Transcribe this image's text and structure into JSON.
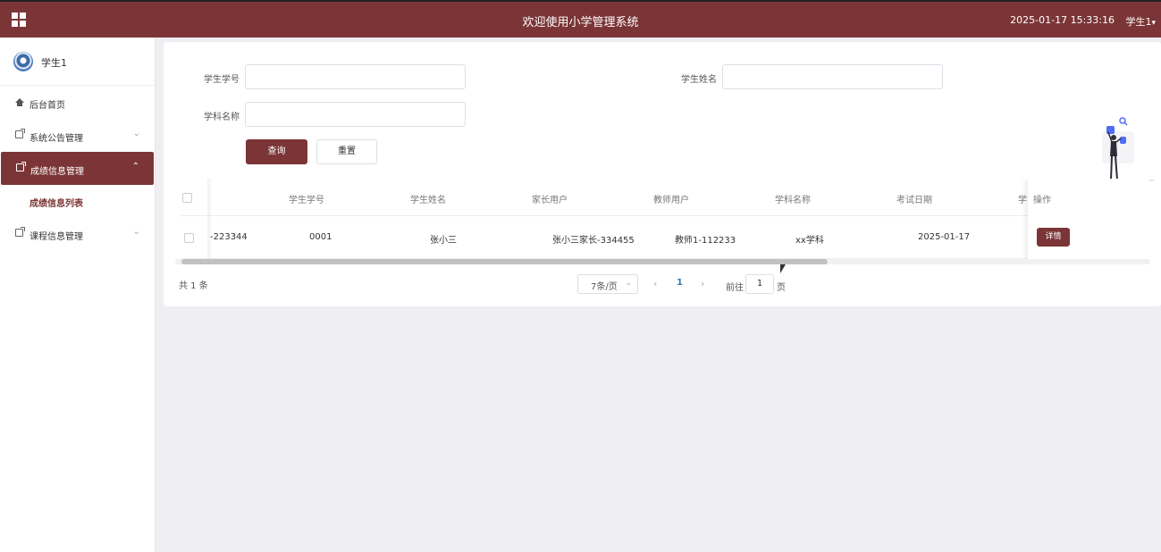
{
  "header": {
    "title": "欢迎使用小学管理系统",
    "datetime": "2025-01-17 15:33:16",
    "user": "学生1",
    "accent_color": "#7b3536"
  },
  "sidebar": {
    "user_name": "学生1",
    "items": [
      {
        "label": "后台首页",
        "icon": "home-icon"
      },
      {
        "label": "系统公告管理",
        "icon": "document-icon"
      },
      {
        "label": "成绩信息管理",
        "icon": "document-icon",
        "active": true
      },
      {
        "label": "课程信息管理",
        "icon": "document-icon"
      }
    ],
    "sub_item": "成绩信息列表"
  },
  "search": {
    "student_no_label": "学生学号",
    "student_name_label": "学生姓名",
    "subject_label": "学科名称",
    "query_button": "查询",
    "reset_button": "重置"
  },
  "table": {
    "columns": [
      "学生学号",
      "学生姓名",
      "家长用户",
      "教师用户",
      "学科名称",
      "考试日期",
      "学"
    ],
    "action_header": "操作",
    "rows": [
      {
        "partial": "-223344",
        "student_no": "0001",
        "student_name": "张小三",
        "parent": "张小三家长-334455",
        "teacher": "教师1-112233",
        "subject": "xx学科",
        "exam_date": "2025-01-17",
        "action": "详情"
      }
    ]
  },
  "pagination": {
    "total": "共 1 条",
    "page_size": "7条/页",
    "current_page": "1",
    "goto_label": "前往",
    "goto_value": "1",
    "goto_unit": "页"
  }
}
